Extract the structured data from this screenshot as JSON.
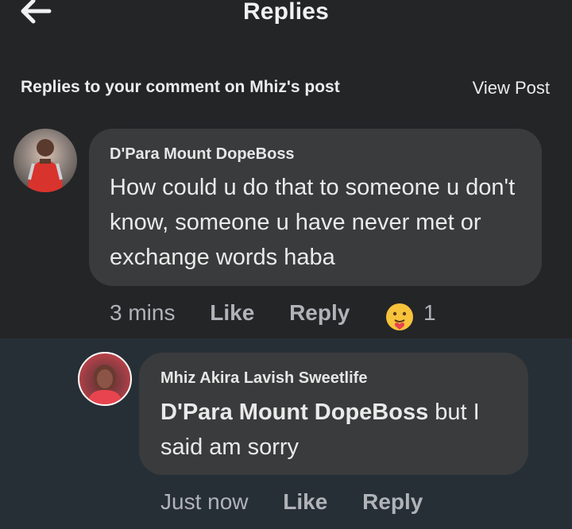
{
  "header": {
    "title": "Replies"
  },
  "subheader": {
    "text": "Replies to your comment on Mhiz's post",
    "view_post_label": "View Post"
  },
  "comment": {
    "author": "D'Para Mount DopeBoss",
    "text": "How could u do that to someone u don't know, someone u have never met or exchange words haba",
    "time": "3 mins",
    "like_label": "Like",
    "reply_label": "Reply",
    "reaction_icon": "care-reaction-icon",
    "reaction_count": "1"
  },
  "reply": {
    "author": "Mhiz Akira Lavish Sweetlife",
    "mention": "D'Para Mount DopeBoss",
    "text": " but I said am sorry",
    "time": "Just now",
    "like_label": "Like",
    "reply_label": "Reply"
  }
}
